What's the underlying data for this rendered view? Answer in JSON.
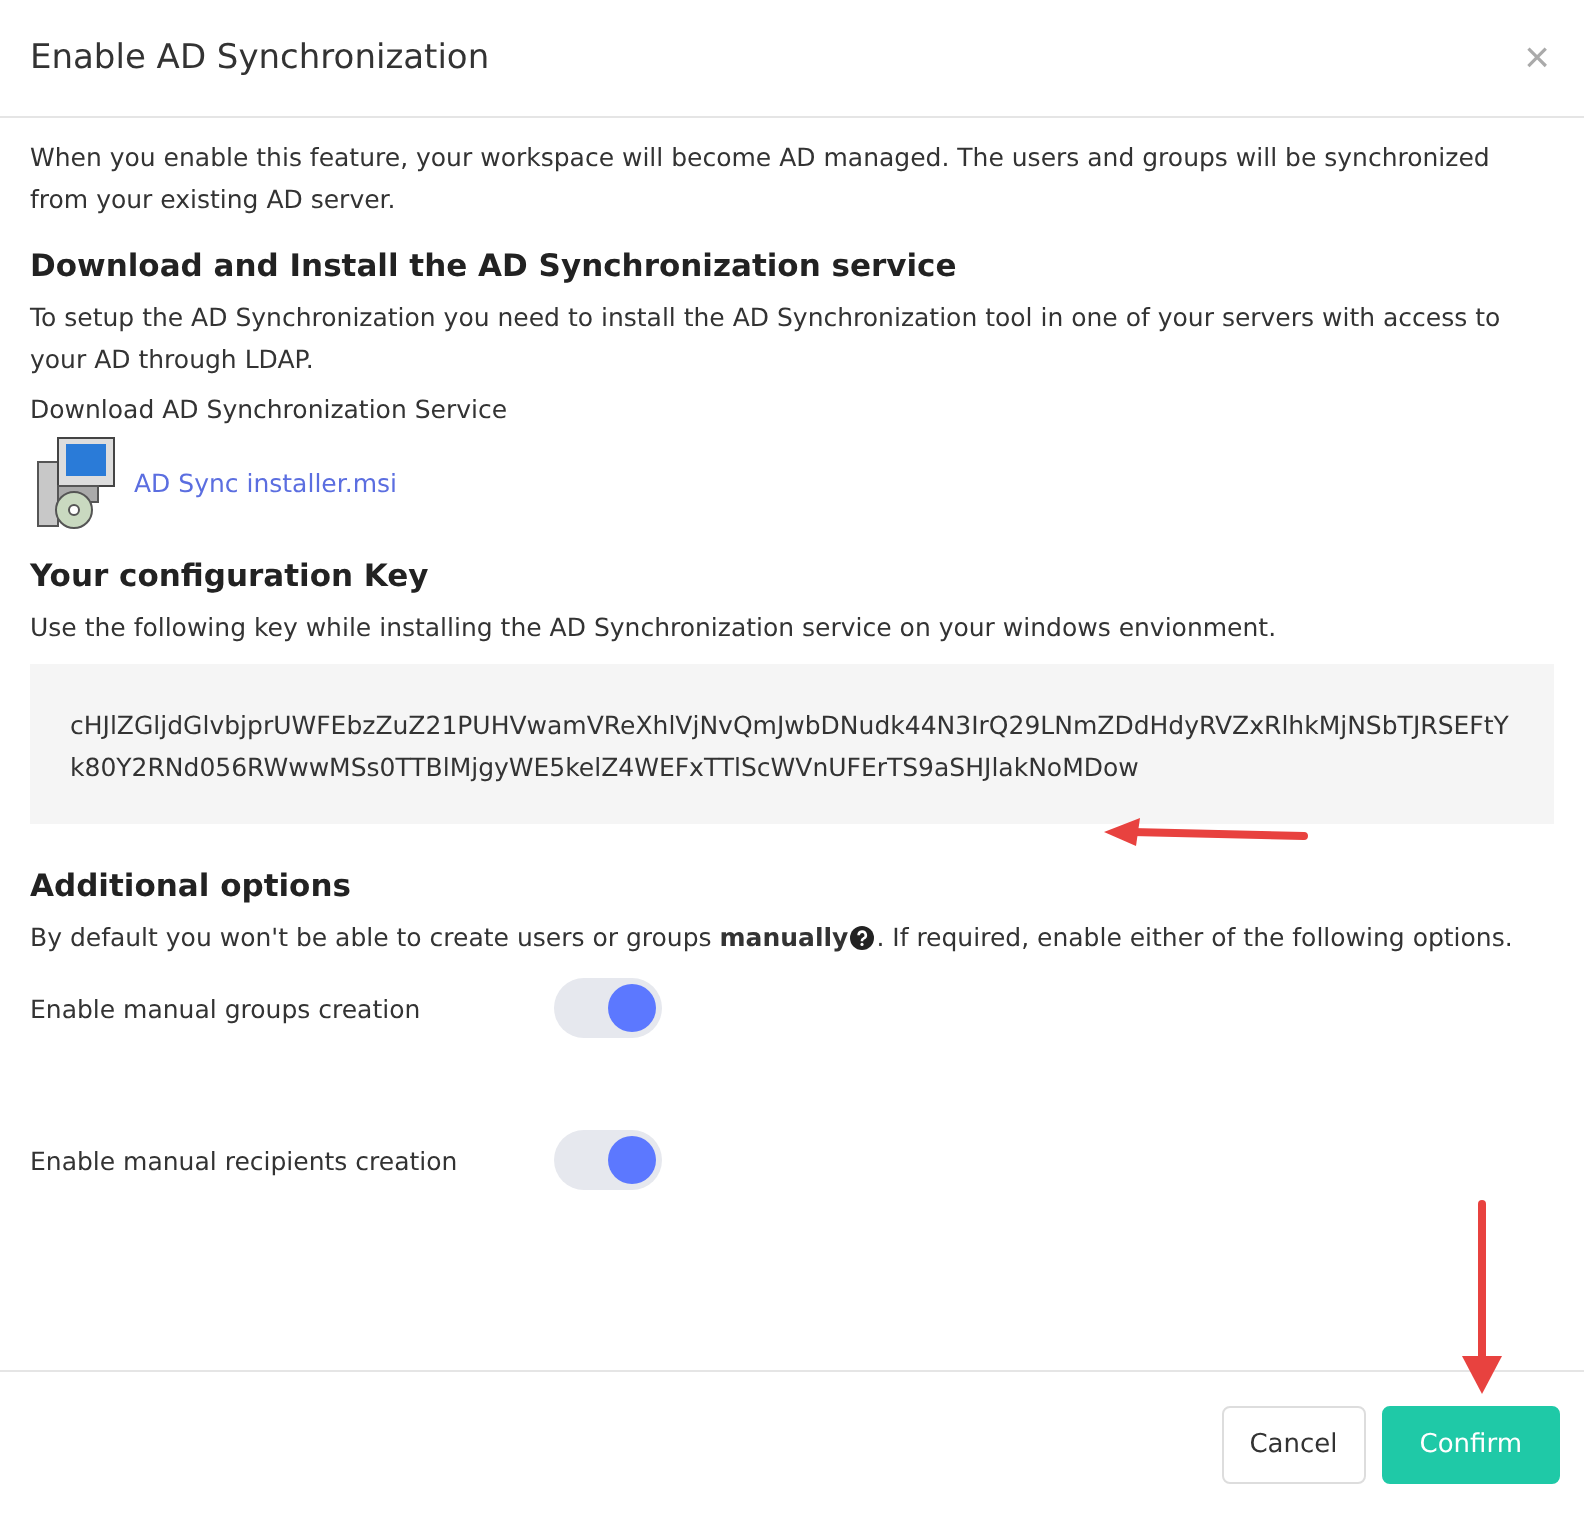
{
  "dialog": {
    "title": "Enable AD Synchronization",
    "close": "×"
  },
  "intro": "When you enable this feature, your workspace will become AD managed. The users and groups will be synchronized from your existing AD server.",
  "download": {
    "heading": "Download and Install the AD Synchronization service",
    "text": "To setup the AD Synchronization you need to install the AD Synchronization tool in one of your servers with access to your AD through LDAP.",
    "label": "Download AD Synchronization Service",
    "file_link": "AD Sync installer.msi"
  },
  "config": {
    "heading": "Your configuration Key",
    "text": "Use the following key while installing the AD Synchronization service on your windows envionment.",
    "key": "cHJlZGljdGlvbjprUWFEbzZuZ21PUHVwamVReXhlVjNvQmJwbDNudk44N3IrQ29LNmZDdHdyRVZxRlhkMjNSbTJRSEFtYk80Y2RNd056RWwwMSs0TTBlMjgyWE5kelZ4WEFxTTlScWVnUFErTS9aSHJlakNoMDow"
  },
  "options": {
    "heading": "Additional options",
    "text_before": "By default you won't be able to create users or groups **manually**",
    "text_after": ". If required, enable either of the following options.",
    "toggles": [
      {
        "label": "Enable manual groups creation",
        "on": true
      },
      {
        "label": "Enable manual recipients creation",
        "on": true
      }
    ]
  },
  "buttons": [
    {
      "label": "Cancel",
      "kind": "secondary"
    },
    {
      "label": "Confirm",
      "kind": "primary"
    }
  ]
}
